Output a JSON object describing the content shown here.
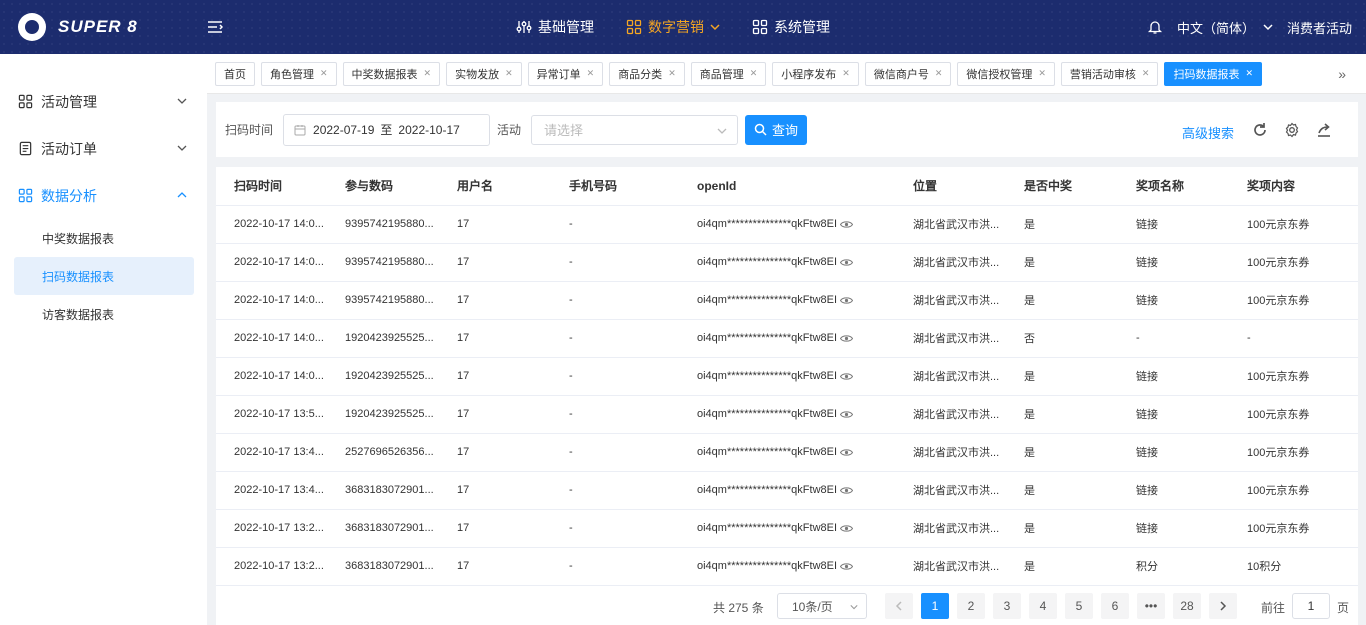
{
  "brand": {
    "name": "SUPER 8"
  },
  "nav": [
    {
      "label": "基础管理",
      "icon": "sliders-icon",
      "active": false
    },
    {
      "label": "数字营销",
      "icon": "grid-icon",
      "active": true
    },
    {
      "label": "系统管理",
      "icon": "grid-icon",
      "active": false
    }
  ],
  "top_right": {
    "language": "中文（简体）",
    "user": "消费者活动"
  },
  "sidebar": {
    "groups": [
      {
        "label": "活动管理"
      },
      {
        "label": "活动订单"
      },
      {
        "label": "数据分析"
      }
    ],
    "subitems": [
      {
        "label": "中奖数据报表"
      },
      {
        "label": "扫码数据报表"
      },
      {
        "label": "访客数据报表"
      }
    ]
  },
  "tabs": [
    {
      "label": "首页"
    },
    {
      "label": "角色管理"
    },
    {
      "label": "中奖数据报表"
    },
    {
      "label": "实物发放"
    },
    {
      "label": "异常订单"
    },
    {
      "label": "商品分类"
    },
    {
      "label": "商品管理"
    },
    {
      "label": "小程序发布"
    },
    {
      "label": "微信商户号"
    },
    {
      "label": "微信授权管理"
    },
    {
      "label": "营销活动审核"
    },
    {
      "label": "扫码数据报表"
    }
  ],
  "filter": {
    "time_label": "扫码时间",
    "start_date": "2022-07-19",
    "separator": "至",
    "end_date": "2022-10-17",
    "activity_label": "活动",
    "activity_placeholder": "请选择",
    "query_label": "查询",
    "advanced_label": "高级搜索"
  },
  "table": {
    "columns": [
      "扫码时间",
      "参与数码",
      "用户名",
      "手机号码",
      "openId",
      "位置",
      "是否中奖",
      "奖项名称",
      "奖项内容"
    ],
    "rows": [
      [
        "2022-10-17 14:0...",
        "9395742195880...",
        "17",
        "-",
        "oi4qm***************qkFtw8EI",
        "湖北省武汉市洪...",
        "是",
        "链接",
        "100元京东券"
      ],
      [
        "2022-10-17 14:0...",
        "9395742195880...",
        "17",
        "-",
        "oi4qm***************qkFtw8EI",
        "湖北省武汉市洪...",
        "是",
        "链接",
        "100元京东券"
      ],
      [
        "2022-10-17 14:0...",
        "9395742195880...",
        "17",
        "-",
        "oi4qm***************qkFtw8EI",
        "湖北省武汉市洪...",
        "是",
        "链接",
        "100元京东券"
      ],
      [
        "2022-10-17 14:0...",
        "1920423925525...",
        "17",
        "-",
        "oi4qm***************qkFtw8EI",
        "湖北省武汉市洪...",
        "否",
        "-",
        "-"
      ],
      [
        "2022-10-17 14:0...",
        "1920423925525...",
        "17",
        "-",
        "oi4qm***************qkFtw8EI",
        "湖北省武汉市洪...",
        "是",
        "链接",
        "100元京东券"
      ],
      [
        "2022-10-17 13:5...",
        "1920423925525...",
        "17",
        "-",
        "oi4qm***************qkFtw8EI",
        "湖北省武汉市洪...",
        "是",
        "链接",
        "100元京东券"
      ],
      [
        "2022-10-17 13:4...",
        "2527696526356...",
        "17",
        "-",
        "oi4qm***************qkFtw8EI",
        "湖北省武汉市洪...",
        "是",
        "链接",
        "100元京东券"
      ],
      [
        "2022-10-17 13:4...",
        "3683183072901...",
        "17",
        "-",
        "oi4qm***************qkFtw8EI",
        "湖北省武汉市洪...",
        "是",
        "链接",
        "100元京东券"
      ],
      [
        "2022-10-17 13:2...",
        "3683183072901...",
        "17",
        "-",
        "oi4qm***************qkFtw8EI",
        "湖北省武汉市洪...",
        "是",
        "链接",
        "100元京东券"
      ],
      [
        "2022-10-17 13:2...",
        "3683183072901...",
        "17",
        "-",
        "oi4qm***************qkFtw8EI",
        "湖北省武汉市洪...",
        "是",
        "积分",
        "10积分"
      ]
    ]
  },
  "pagination": {
    "total": "共 275 条",
    "page_size": "10条/页",
    "pages": [
      "1",
      "2",
      "3",
      "4",
      "5",
      "6",
      "•••",
      "28"
    ],
    "current": "1",
    "goto_label": "前往",
    "goto_value": "1",
    "page_suffix": "页"
  },
  "colors": {
    "header_bg": "#1c2c6e",
    "accent": "#1890ff",
    "nav_active": "#f5a623"
  }
}
